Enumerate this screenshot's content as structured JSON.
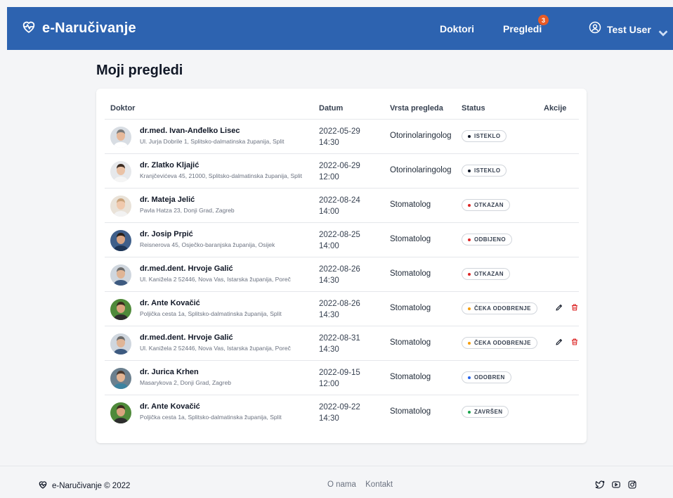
{
  "app": {
    "brand": "e-Naručivanje"
  },
  "nav": {
    "doktori": "Doktori",
    "pregledi": "Pregledi",
    "pregledi_badge": "3",
    "user": "Test User"
  },
  "page": {
    "title": "Moji pregledi"
  },
  "table": {
    "headers": {
      "doktor": "Doktor",
      "datum": "Datum",
      "vrsta": "Vrsta pregleda",
      "status": "Status",
      "akcije": "Akcije"
    },
    "rows": [
      {
        "name": "dr.med. Ivan-Anđelko Lisec",
        "address": "Ul. Jurja Dobrile 1, Splitsko-dalmatinska županija, Split",
        "date": "2022-05-29",
        "time": "14:30",
        "type": "Otorinolaringolog",
        "status": "ISTEKLO",
        "status_color": "#111827",
        "actions": false
      },
      {
        "name": "dr. Zlatko Kljajić",
        "address": "Kranjčevićeva 45, 21000, Splitsko-dalmatinska županija, Split",
        "date": "2022-06-29",
        "time": "12:00",
        "type": "Otorinolaringolog",
        "status": "ISTEKLO",
        "status_color": "#111827",
        "actions": false
      },
      {
        "name": "dr. Mateja Jelić",
        "address": "Pavla Hatza 23, Donji Grad, Zagreb",
        "date": "2022-08-24",
        "time": "14:00",
        "type": "Stomatolog",
        "status": "OTKAZAN",
        "status_color": "#dc2626",
        "actions": false
      },
      {
        "name": "dr. Josip Prpić",
        "address": "Reisnerova 45, Osječko-baranjska županija, Osijek",
        "date": "2022-08-25",
        "time": "14:00",
        "type": "Stomatolog",
        "status": "ODBIJENO",
        "status_color": "#dc2626",
        "actions": false
      },
      {
        "name": "dr.med.dent. Hrvoje Galić",
        "address": "Ul. Kanižela 2 52446, Nova Vas, Istarska županija, Poreč",
        "date": "2022-08-26",
        "time": "14:30",
        "type": "Stomatolog",
        "status": "OTKAZAN",
        "status_color": "#dc2626",
        "actions": false
      },
      {
        "name": "dr. Ante Kovačić",
        "address": "Poljička cesta 1a, Splitsko-dalmatinska županija, Split",
        "date": "2022-08-26",
        "time": "14:30",
        "type": "Stomatolog",
        "status": "ČEKA ODOBRENJE",
        "status_color": "#f59e0b",
        "actions": true
      },
      {
        "name": "dr.med.dent. Hrvoje Galić",
        "address": "Ul. Kanižela 2 52446, Nova Vas, Istarska županija, Poreč",
        "date": "2022-08-31",
        "time": "14:30",
        "type": "Stomatolog",
        "status": "ČEKA ODOBRENJE",
        "status_color": "#f59e0b",
        "actions": true
      },
      {
        "name": "dr. Jurica Krhen",
        "address": "Masarykova 2, Donji Grad, Zagreb",
        "date": "2022-09-15",
        "time": "12:00",
        "type": "Stomatolog",
        "status": "ODOBREN",
        "status_color": "#2563eb",
        "actions": false
      },
      {
        "name": "dr. Ante Kovačić",
        "address": "Poljička cesta 1a, Splitsko-dalmatinska županija, Split",
        "date": "2022-09-22",
        "time": "14:30",
        "type": "Stomatolog",
        "status": "ZAVRŠEN",
        "status_color": "#16a34a",
        "actions": false
      }
    ]
  },
  "footer": {
    "copyright": "e-Naručivanje © 2022",
    "links": [
      "O nama",
      "Kontakt"
    ],
    "socials": [
      "twitter-icon",
      "youtube-icon",
      "instagram-icon"
    ]
  },
  "colors": {
    "navbar": "#2d63b0",
    "badge": "#e85a24",
    "delete": "#dc2626"
  }
}
